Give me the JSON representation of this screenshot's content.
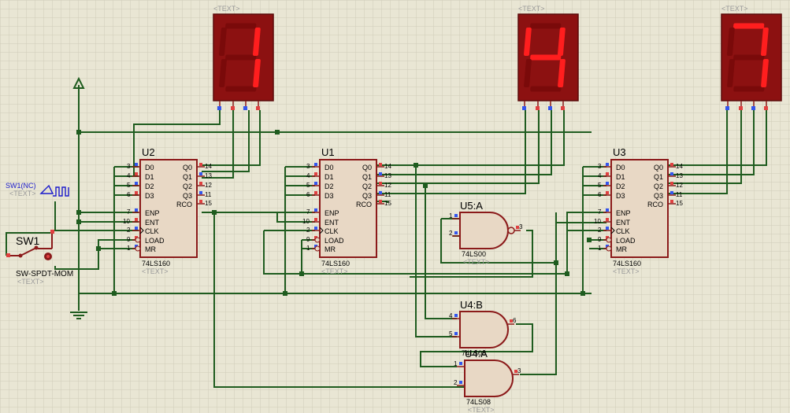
{
  "colors": {
    "background": "#e9e6d4",
    "grid": "#cfccb9",
    "wire": "#1f5c1f",
    "chip_fill": "#e8d8c5",
    "chip_border": "#8b1a1a",
    "seg_bg": "#8c1111",
    "seg_on": "#ff1e1e",
    "seg_off": "#7a0a0a",
    "pin_red": "#e04040",
    "pin_blue": "#3355ee",
    "text_dark": "#000000",
    "text_ghost": "#9a9a9a",
    "text_blue": "#1a1acc"
  },
  "placeholder": "<TEXT>",
  "displays": [
    {
      "id": "display-left",
      "digit": "1"
    },
    {
      "id": "display-mid",
      "digit": "4"
    },
    {
      "id": "display-right",
      "digit": "7"
    }
  ],
  "counters": [
    {
      "name": "U2",
      "part": "74LS160",
      "text": "<TEXT>"
    },
    {
      "name": "U1",
      "part": "74LS160",
      "text": "<TEXT>"
    },
    {
      "name": "U3",
      "part": "74LS160",
      "text": "<TEXT>"
    }
  ],
  "counter_left_pins": [
    {
      "num": "3",
      "name": "D0"
    },
    {
      "num": "4",
      "name": "D1"
    },
    {
      "num": "5",
      "name": "D2"
    },
    {
      "num": "6",
      "name": "D3"
    },
    {
      "num": "7",
      "name": "ENP"
    },
    {
      "num": "10",
      "name": "ENT"
    },
    {
      "num": "2",
      "name": "CLK"
    },
    {
      "num": "9",
      "name": "LOAD"
    },
    {
      "num": "1",
      "name": "MR"
    }
  ],
  "counter_right_pins": [
    {
      "num": "14",
      "name": "Q0"
    },
    {
      "num": "13",
      "name": "Q1"
    },
    {
      "num": "12",
      "name": "Q2"
    },
    {
      "num": "11",
      "name": "Q3"
    },
    {
      "num": "15",
      "name": "RCO"
    }
  ],
  "gates": [
    {
      "name": "U5:A",
      "part": "74LS00",
      "text": "<TEXT>",
      "in1": "1",
      "in2": "2",
      "out": "3"
    },
    {
      "name": "U4:B",
      "part": "74LS08",
      "text": "",
      "in1": "4",
      "in2": "5",
      "out": "6"
    },
    {
      "name": "U4:A",
      "part": "74LS08",
      "text": "<TEXT>",
      "in1": "1",
      "in2": "2",
      "out": "3"
    }
  ],
  "switch": {
    "name": "SW1",
    "part": "SW-SPDT-MOM",
    "text": "<TEXT>"
  },
  "clock": {
    "name": "SW1(NC)",
    "text": "<TEXT>"
  }
}
